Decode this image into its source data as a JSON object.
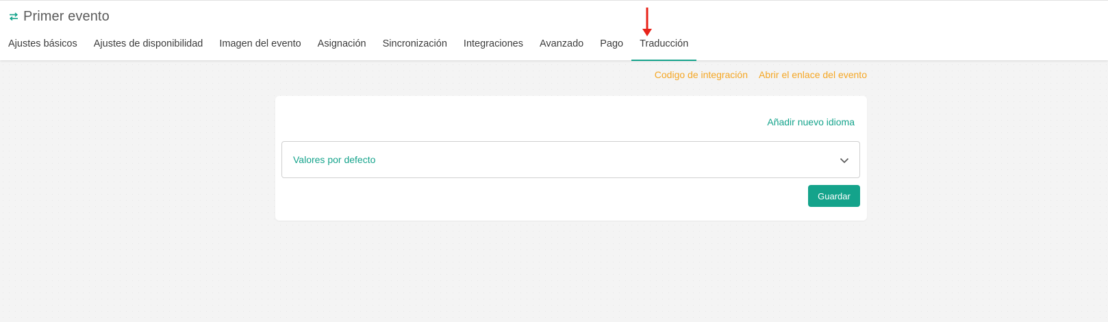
{
  "header": {
    "title": "Primer evento",
    "title_icon": "swap-arrows-icon",
    "accent_color": "#14a38b"
  },
  "tabs": [
    {
      "label": "Ajustes básicos"
    },
    {
      "label": "Ajustes de disponibilidad"
    },
    {
      "label": "Imagen del evento"
    },
    {
      "label": "Asignación"
    },
    {
      "label": "Sincronización"
    },
    {
      "label": "Integraciones"
    },
    {
      "label": "Avanzado"
    },
    {
      "label": "Pago"
    },
    {
      "label": "Traducción",
      "active": true
    }
  ],
  "annotation": {
    "arrow_icon": "red-down-arrow-icon",
    "color": "#e8231a"
  },
  "links": {
    "integration_code": "Codigo de integración",
    "open_event_link": "Abrir el enlace del evento",
    "link_color": "#f5a623"
  },
  "translation_card": {
    "add_language": "Añadir nuevo idioma",
    "dropdown_value": "Valores por defecto",
    "save_label": "Guardar"
  }
}
